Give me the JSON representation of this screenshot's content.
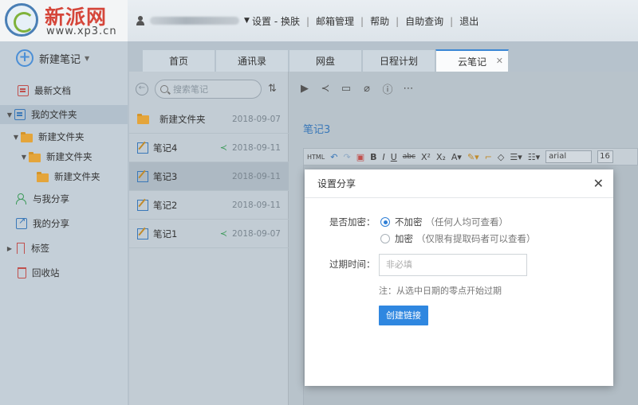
{
  "logo": {
    "text": "新派网",
    "url": "www.xp3.cn"
  },
  "topbar": {
    "links": [
      "设置 - 换肤",
      "邮箱管理",
      "帮助",
      "自助查询",
      "退出"
    ]
  },
  "sidebar": {
    "new_note_label": "新建笔记",
    "items": [
      {
        "label": "最新文档"
      },
      {
        "label": "我的文件夹"
      },
      {
        "label": "新建文件夹"
      },
      {
        "label": "新建文件夹"
      },
      {
        "label": "新建文件夹"
      },
      {
        "label": "与我分享"
      },
      {
        "label": "我的分享"
      },
      {
        "label": "标签"
      },
      {
        "label": "回收站"
      }
    ]
  },
  "tabs": [
    {
      "label": "首页"
    },
    {
      "label": "通讯录"
    },
    {
      "label": "网盘"
    },
    {
      "label": "日程计划"
    },
    {
      "label": "云笔记",
      "active": true
    }
  ],
  "list": {
    "search_placeholder": "搜索笔记",
    "rows": [
      {
        "name": "新建文件夹",
        "date": "2018-09-07",
        "type": "folder",
        "shared": false
      },
      {
        "name": "笔记4",
        "date": "2018-09-11",
        "type": "note",
        "shared": true
      },
      {
        "name": "笔记3",
        "date": "2018-09-11",
        "type": "note",
        "shared": false,
        "selected": true
      },
      {
        "name": "笔记2",
        "date": "2018-09-11",
        "type": "note",
        "shared": false
      },
      {
        "name": "笔记1",
        "date": "2018-09-07",
        "type": "note",
        "shared": true
      }
    ]
  },
  "editor": {
    "title": "笔记3",
    "font": "arial",
    "font_size": "16"
  },
  "modal": {
    "title": "设置分享",
    "encrypt_label": "是否加密：",
    "option_none": "不加密",
    "option_none_hint": "（任何人均可查看）",
    "option_encrypt": "加密",
    "option_encrypt_hint": "（仅限有提取码者可以查看）",
    "expire_label": "过期时间：",
    "expire_placeholder": "非必填",
    "expire_note": "注：从选中日期的零点开始过期",
    "create_button": "创建链接"
  },
  "colors": {
    "accent": "#2f87e0",
    "active_tab_border": "#3a86d4",
    "share_green": "#3d9a5a"
  }
}
